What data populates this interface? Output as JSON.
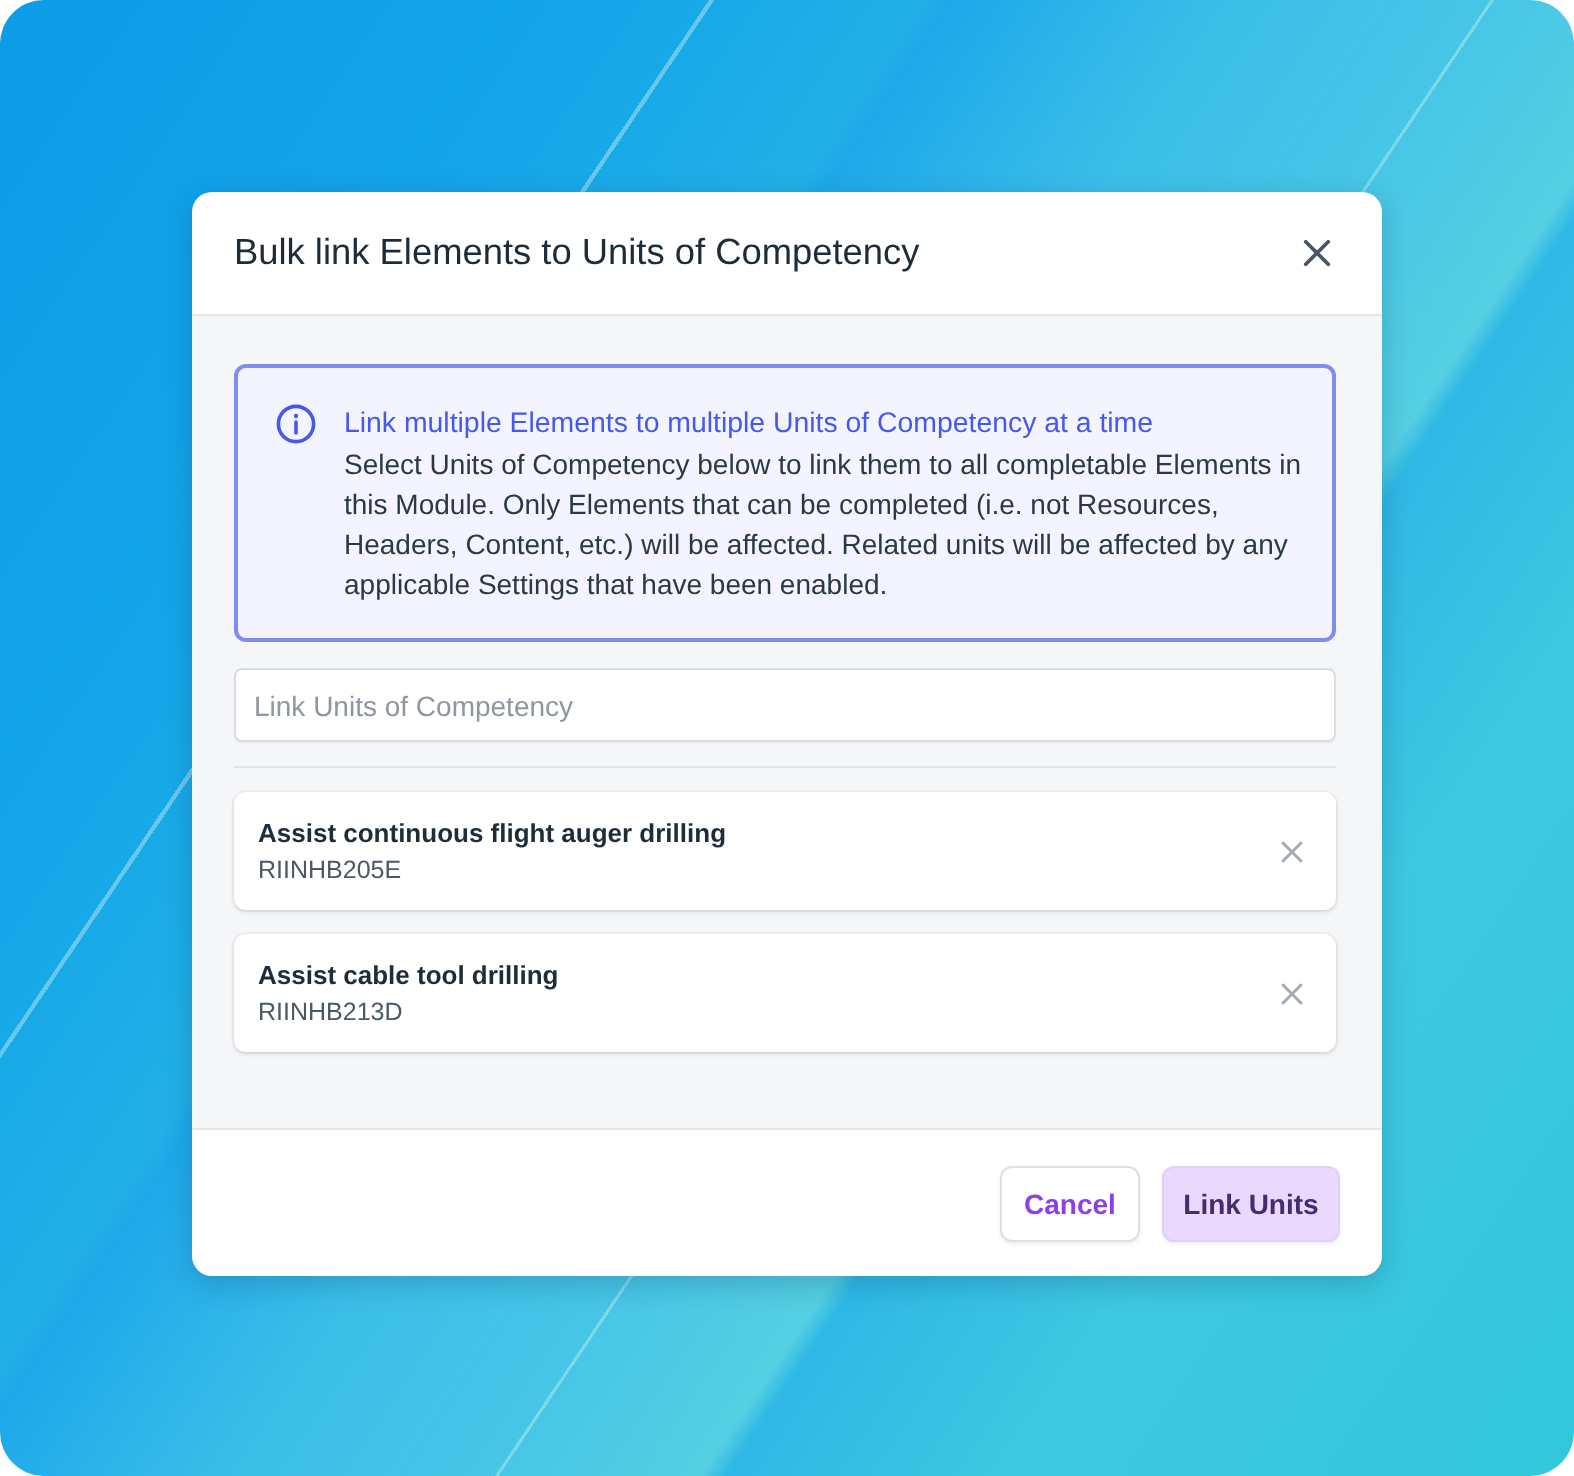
{
  "dialog": {
    "title": "Bulk link Elements to Units of Competency"
  },
  "info": {
    "title": "Link multiple Elements to multiple Units of Competency at a time",
    "text": "Select Units of Competency below to link them to all completable Elements in this Module. Only Elements that can be completed (i.e. not Resources, Headers, Content, etc.) will be affected. Related units will be affected by any applicable Settings that have been enabled."
  },
  "search": {
    "placeholder": "Link Units of Competency"
  },
  "units": [
    {
      "name": "Assist continuous flight auger drilling",
      "code": "RIINHB205E"
    },
    {
      "name": "Assist cable tool drilling",
      "code": "RIINHB213D"
    }
  ],
  "buttons": [
    {
      "label": "Cancel",
      "kind": "secondary"
    },
    {
      "label": "Link Units",
      "kind": "primary"
    }
  ]
}
